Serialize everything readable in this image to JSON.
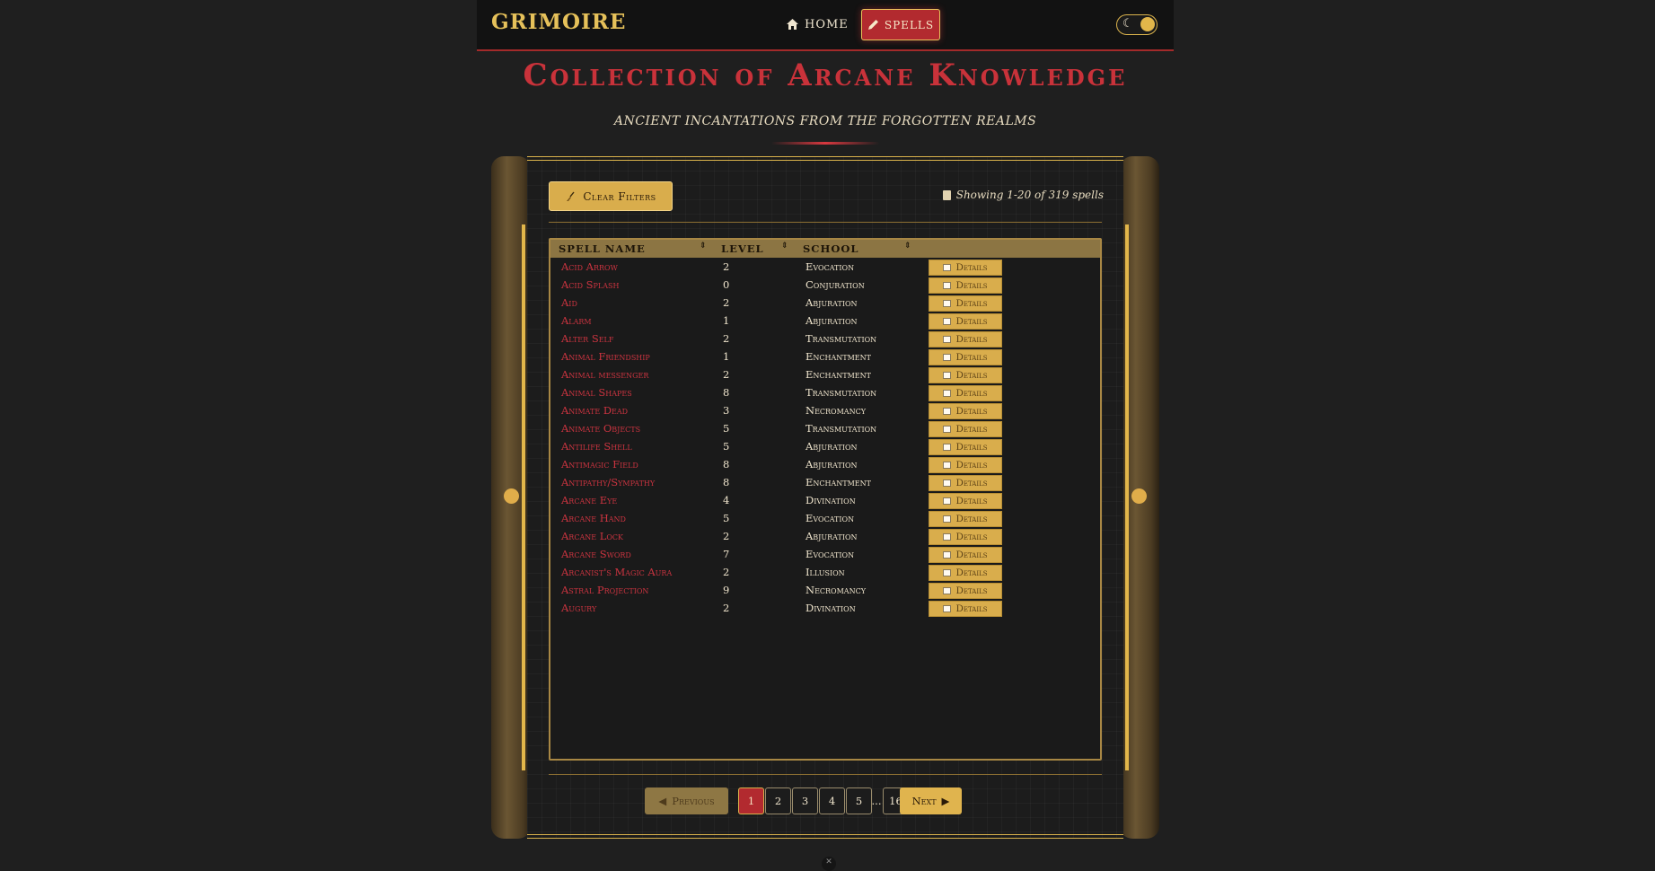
{
  "navbar": {
    "brand": "GRIMOIRE",
    "home_label": "HOME",
    "spells_label": "SPELLS",
    "theme_icon": "moon-icon"
  },
  "hero": {
    "title": "Collection of Arcane Knowledge",
    "subtitle": "ANCIENT INCANTATIONS FROM THE FORGOTTEN REALMS"
  },
  "toolbar": {
    "clear_label": "Clear Filters",
    "showing_text": "Showing 1-20 of 319 spells"
  },
  "table": {
    "columns": [
      "SPELL NAME",
      "LEVEL",
      "SCHOOL"
    ],
    "sort_glyph": "⇕",
    "details_label": "Details",
    "rows": [
      {
        "name": "Acid Arrow",
        "level": "2",
        "school": "Evocation"
      },
      {
        "name": "Acid Splash",
        "level": "0",
        "school": "Conjuration"
      },
      {
        "name": "Aid",
        "level": "2",
        "school": "Abjuration"
      },
      {
        "name": "Alarm",
        "level": "1",
        "school": "Abjuration"
      },
      {
        "name": "Alter Self",
        "level": "2",
        "school": "Transmutation"
      },
      {
        "name": "Animal Friendship",
        "level": "1",
        "school": "Enchantment"
      },
      {
        "name": "Animal messenger",
        "level": "2",
        "school": "Enchantment"
      },
      {
        "name": "Animal Shapes",
        "level": "8",
        "school": "Transmutation"
      },
      {
        "name": "Animate Dead",
        "level": "3",
        "school": "Necromancy"
      },
      {
        "name": "Animate Objects",
        "level": "5",
        "school": "Transmutation"
      },
      {
        "name": "Antilife Shell",
        "level": "5",
        "school": "Abjuration"
      },
      {
        "name": "Antimagic Field",
        "level": "8",
        "school": "Abjuration"
      },
      {
        "name": "Antipathy/Sympathy",
        "level": "8",
        "school": "Enchantment"
      },
      {
        "name": "Arcane Eye",
        "level": "4",
        "school": "Divination"
      },
      {
        "name": "Arcane Hand",
        "level": "5",
        "school": "Evocation"
      },
      {
        "name": "Arcane Lock",
        "level": "2",
        "school": "Abjuration"
      },
      {
        "name": "Arcane Sword",
        "level": "7",
        "school": "Evocation"
      },
      {
        "name": "Arcanist's Magic Aura",
        "level": "2",
        "school": "Illusion"
      },
      {
        "name": "Astral Projection",
        "level": "9",
        "school": "Necromancy"
      },
      {
        "name": "Augury",
        "level": "2",
        "school": "Divination"
      }
    ]
  },
  "pagination": {
    "prev_label": "Previous",
    "next_label": "Next",
    "pages": [
      "1",
      "2",
      "3",
      "4",
      "5"
    ],
    "ellipsis": "...",
    "last_page": "16",
    "current": "1"
  },
  "colors": {
    "accent_gold": "#d9ad4c",
    "accent_red": "#c9323a",
    "background": "#1f1f1f"
  }
}
